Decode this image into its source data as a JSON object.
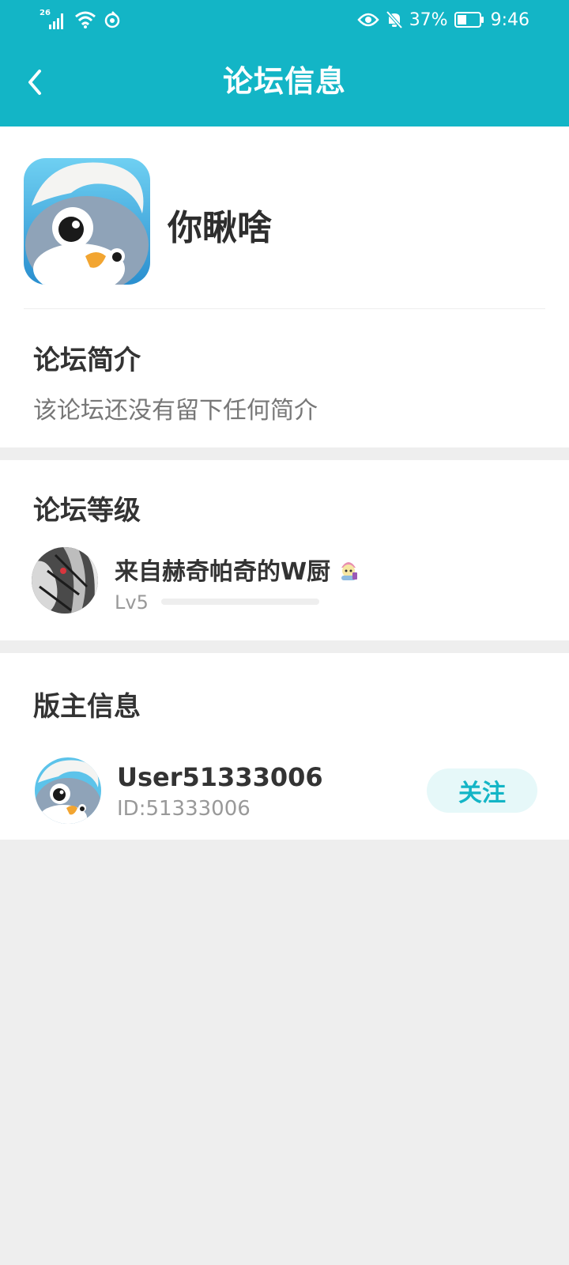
{
  "status_bar": {
    "network": "26",
    "battery_percent": "37%",
    "time": "9:46"
  },
  "header": {
    "title": "论坛信息"
  },
  "forum": {
    "name": "你瞅啥"
  },
  "intro": {
    "title": "论坛简介",
    "text": "该论坛还没有留下任何简介"
  },
  "level": {
    "title": "论坛等级",
    "user_name": "来自赫奇帕奇的W厨",
    "level_label": "Lv5",
    "progress": 0
  },
  "moderator": {
    "title": "版主信息",
    "name": "User51333006",
    "id": "ID:51333006",
    "follow_label": "关注"
  },
  "colors": {
    "accent": "#13b5c6",
    "follow_bg": "#e6f8f9",
    "page_bg": "#eeeeee"
  },
  "icons": [
    "signal-icon",
    "wifi-icon",
    "hotspot-icon",
    "eye-icon",
    "bell-off-icon",
    "battery-icon",
    "back-icon",
    "wizard-badge-icon"
  ]
}
